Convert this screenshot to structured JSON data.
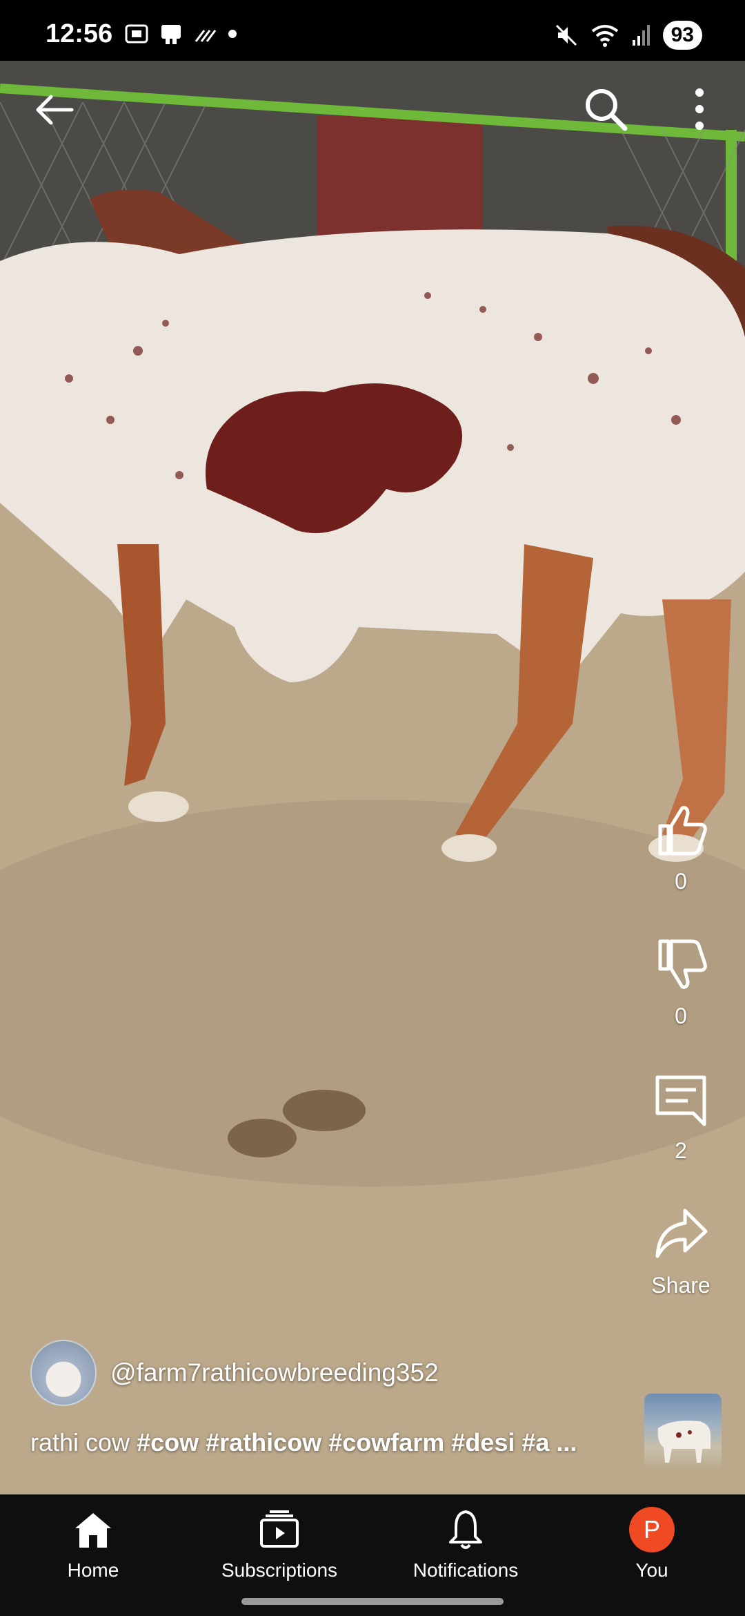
{
  "status_bar": {
    "time": "12:56",
    "battery": "93"
  },
  "top_bar": {
    "back_icon": "arrow-left-icon",
    "search_icon": "search-icon",
    "more_icon": "more-vertical-icon"
  },
  "actions": {
    "like": {
      "icon": "thumbs-up-icon",
      "count": "0"
    },
    "dislike": {
      "icon": "thumbs-down-icon",
      "count": "0"
    },
    "comments": {
      "icon": "comment-icon",
      "count": "2"
    },
    "share": {
      "icon": "share-icon",
      "label": "Share"
    }
  },
  "channel": {
    "handle": "@farm7rathicowbreeding352"
  },
  "caption": {
    "text": "rathi cow",
    "tags": [
      "#cow",
      "#rathicow",
      "#cowfarm",
      "#desi",
      "#a ..."
    ]
  },
  "bottom_nav": {
    "items": [
      {
        "label": "Home",
        "icon": "home-icon"
      },
      {
        "label": "Subscriptions",
        "icon": "subscriptions-icon"
      },
      {
        "label": "Notifications",
        "icon": "bell-icon"
      },
      {
        "label": "You",
        "icon": "avatar",
        "initial": "P"
      }
    ]
  },
  "colors": {
    "accent_avatar": "#ef4a23",
    "nav_bg": "#0f0f0f"
  }
}
